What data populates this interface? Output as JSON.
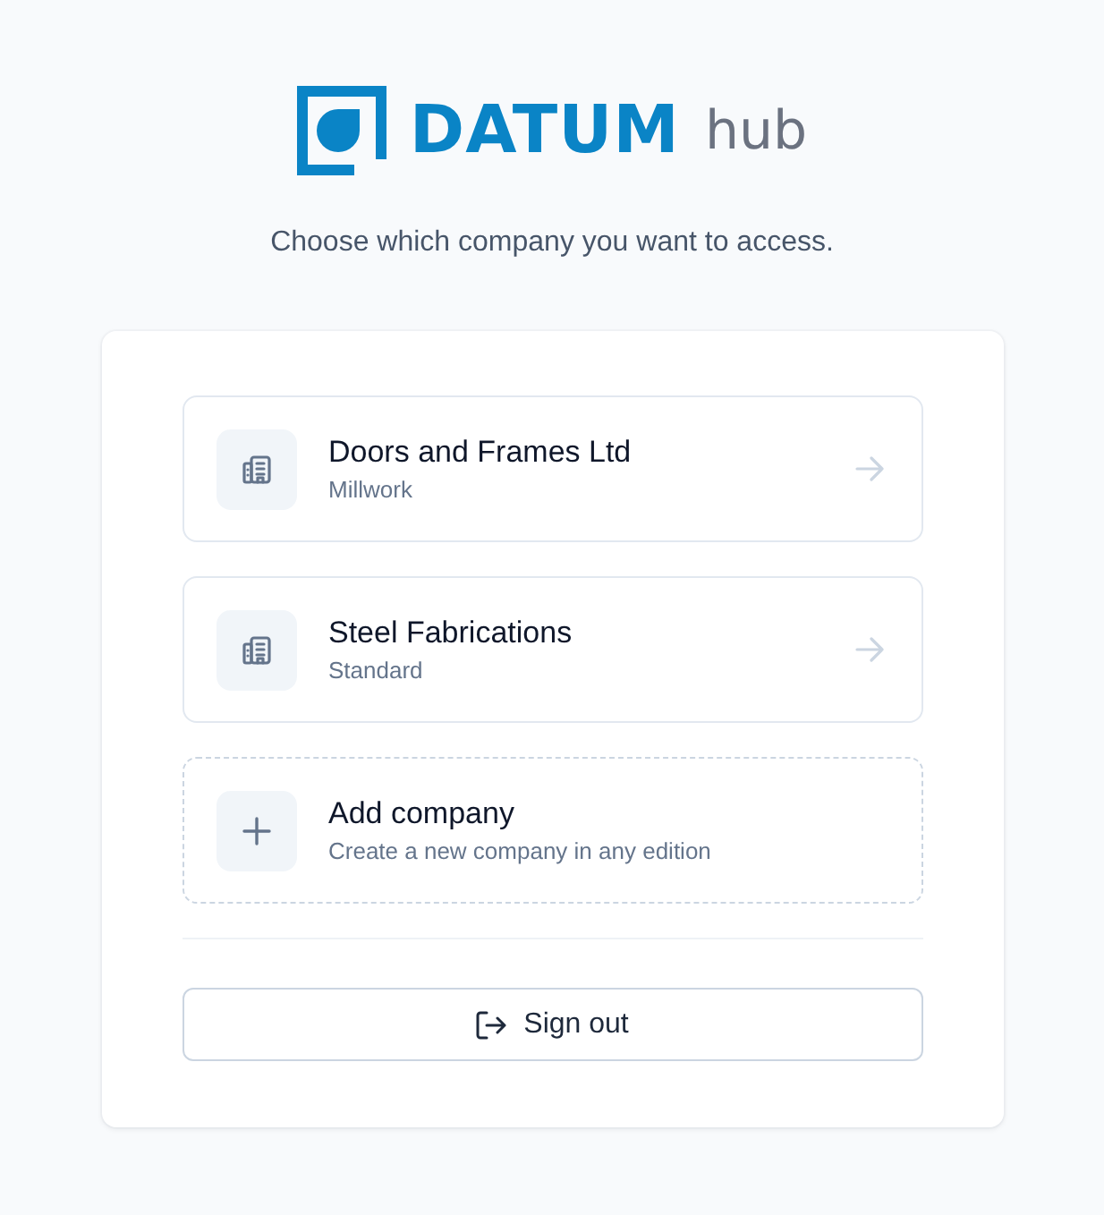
{
  "logo": {
    "wordmark": "DATUM",
    "suffix": "hub"
  },
  "prompt": "Choose which company you want to access.",
  "options": [
    {
      "kind": "company",
      "title": "Doors and Frames Ltd",
      "subtitle": "Millwork"
    },
    {
      "kind": "company",
      "title": "Steel Fabrications",
      "subtitle": "Standard"
    },
    {
      "kind": "add",
      "title": "Add company",
      "subtitle": "Create a new company in any edition"
    }
  ],
  "sign_out": {
    "label": "Sign out"
  }
}
